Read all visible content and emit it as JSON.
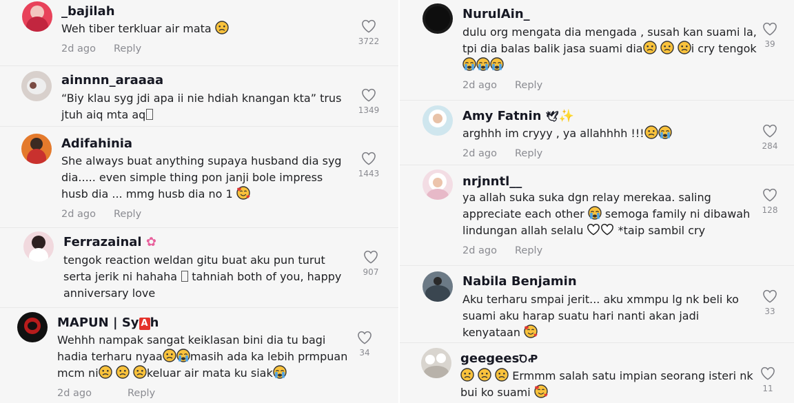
{
  "left": [
    {
      "user": "_bajilah",
      "text": "Weh tiber terkluar air mata 😟",
      "time": "2d ago",
      "reply": "Reply",
      "likes": "3722"
    },
    {
      "user": "ainnnn_araaaa",
      "text": "“Biy klau syg jdi apa ii nie hdiah knangan kta” trus jtuh aiq mta aq",
      "time": "",
      "reply": "",
      "likes": "1349"
    },
    {
      "user": "Adifahinia",
      "text": "She always buat anything supaya husband dia syg dia..... even simple thing pon janji bole impress husb dia ... mmg husb dia no 1 🥰",
      "time": "2d ago",
      "reply": "Reply",
      "likes": "1443"
    },
    {
      "user": "Ferrazainal 🌸",
      "text": "tengok reaction weldan gitu buat aku pun turut serta jerik ni hahaha  tahniah both of you, happy anniversary love",
      "time": "",
      "reply": "",
      "likes": "907"
    },
    {
      "user_pre": "MAPUN | Sy",
      "user_badge": "A",
      "user_post": "h",
      "text": "Wehhh nampak sangat keiklasan bini dia tu bagi hadia terharu nyaa😟😭masih ada ka lebih prmpuan mcm ni😟😟😟keluar air mata ku siak😭",
      "time": "2d ago",
      "reply": "Reply",
      "likes": "34"
    }
  ],
  "right": [
    {
      "user": "NurulAin_",
      "text": "dulu org mengata dia mengada , susah kan suami la, tpi dia balas balik jasa suami dia😟😟😟i cry tengok 😭😭😭",
      "time": "2d ago",
      "reply": "Reply",
      "likes": "39"
    },
    {
      "user": "Amy Fatnin 🕊✨",
      "text": "arghhh im cryyy , ya allahhhh !!!😟😭",
      "time": "2d ago",
      "reply": "Reply",
      "likes": "284"
    },
    {
      "user": "nrjnntl__",
      "text": "ya allah suka suka dgn relay merekaa. saling appreciate each other 😭 semoga family ni dibawah lindungan allah selalu 🤍🤍 *taip sambil cry",
      "time": "2d ago",
      "reply": "Reply",
      "likes": "128"
    },
    {
      "user": "Nabila Benjamin",
      "text": "Aku terharu smpai jerit... aku xmmpu lg nk beli ko suami aku harap suatu hari nanti akan jadi kenyataan 🥰",
      "time": "",
      "reply": "",
      "likes": "33"
    },
    {
      "user": "geegees??",
      "text": "😟😟😟 Ermmm salah satu impian seorang isteri nk bui ko suami 🥰",
      "time": "",
      "reply": "",
      "likes": "11"
    }
  ],
  "colors": {
    "accent": "#fe2c55",
    "text": "#161823",
    "meta": "#8a8b91",
    "background": "#f6f6f6"
  }
}
